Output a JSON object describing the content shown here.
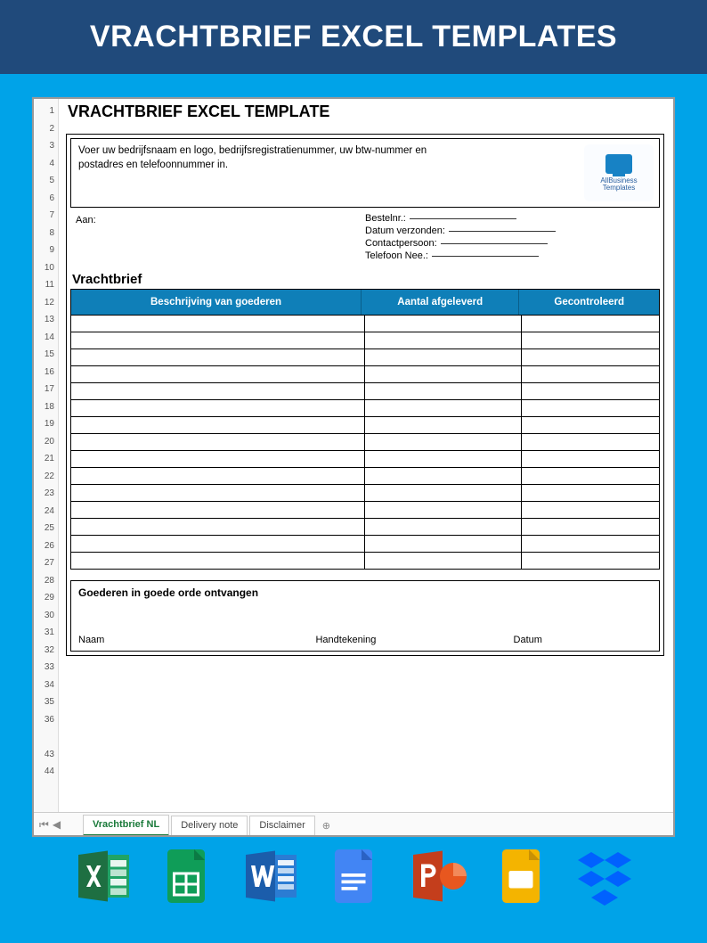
{
  "banner": {
    "title": "VRACHTBRIEF EXCEL TEMPLATES"
  },
  "rownums": [
    "1",
    "2",
    "3",
    "4",
    "5",
    "6",
    "7",
    "8",
    "9",
    "10",
    "11",
    "12",
    "13",
    "14",
    "15",
    "16",
    "17",
    "18",
    "19",
    "20",
    "21",
    "22",
    "23",
    "24",
    "25",
    "26",
    "27",
    "28",
    "29",
    "30",
    "31",
    "32",
    "33",
    "34",
    "35",
    "36",
    "",
    "43",
    "44"
  ],
  "doc": {
    "title": "VRACHTBRIEF EXCEL TEMPLATE",
    "headerText": "Voer uw bedrijfsnaam en logo, bedrijfsregistratienummer, uw btw-nummer en postadres en telefoonnummer in.",
    "badge": {
      "l1": "AllBusiness",
      "l2": "Templates"
    },
    "aan": "Aan:",
    "right": {
      "bestelnr": "Bestelnr.:",
      "datum": "Datum verzonden:",
      "contact": "Contactpersoon:",
      "tel": "Telefoon Nee.:"
    },
    "section": "Vrachtbrief",
    "columns": {
      "desc": "Beschrijving van goederen",
      "qty": "Aantal afgeleverd",
      "chk": "Gecontroleerd"
    },
    "emptyRows": 15,
    "receipt": {
      "title": "Goederen in goede orde ontvangen",
      "naam": "Naam",
      "hand": "Handtekening",
      "datum": "Datum"
    }
  },
  "tabs": {
    "active": "Vrachtbrief NL",
    "t2": "Delivery note",
    "t3": "Disclaimer",
    "add": "⊕"
  },
  "apps": [
    "excel",
    "sheets",
    "word",
    "docs",
    "powerpoint",
    "slides",
    "dropbox"
  ]
}
